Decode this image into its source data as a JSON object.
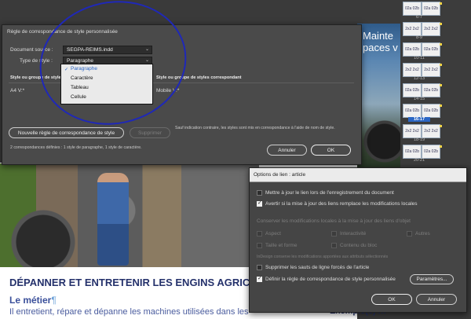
{
  "document": {
    "top_title_lines": [
      "Mainte",
      "paces v"
    ],
    "heading": "DÉPANNER ET ENTRETENIR LES ENGINS AGRICOLES",
    "pilcrow": "¶",
    "subheading": "Le métier",
    "body_text": "Il entretient, répare et dépanne les machines utilisées dans les",
    "right_text": "Exemple(s) m"
  },
  "pages": [
    {
      "thumb": "02a 02b",
      "label": "6-7"
    },
    {
      "thumb": "2x2 2x2",
      "label": "8-9"
    },
    {
      "thumb": "02a 02b",
      "label": "10-11"
    },
    {
      "thumb": "2x2 2x2",
      "label": "12-13"
    },
    {
      "thumb": "02a 02b",
      "label": "14-15"
    },
    {
      "thumb": "02a 02b",
      "label": "16-17",
      "selected": true
    },
    {
      "thumb": "2x2 2x2",
      "label": "18-19"
    },
    {
      "thumb": "02a 02b",
      "label": "20-21"
    }
  ],
  "dialog1": {
    "title": "Règle de correspondance de style personnalisée",
    "source_label": "Document source :",
    "source_value": "SEGPA-REIMS.indd",
    "type_label": "Type de style :",
    "type_value": "Paragraphe",
    "col1_header": "Style ou groupe de style",
    "col2_header": "Style ou groupe de styles correspondant",
    "row_left": "A4 V:*",
    "row_right": "Mobile V:*",
    "options": [
      "Paragraphe",
      "Caractère",
      "Tableau",
      "Cellule"
    ],
    "selected_option": "Paragraphe",
    "new_rule_button": "Nouvelle règle de correspondance de style",
    "delete_button": "Supprimer",
    "note": "Sauf indication contraire, les styles sont mis en correspondance à l'aide de nom de style.",
    "count_text": "2 correspondances définies : 1 style de paragraphe, 1 style de caractère.",
    "cancel_button": "Annuler",
    "ok_button": "OK"
  },
  "dialog2": {
    "title": "Options de lien : article",
    "cb1": "Mettre à jour le lien lors de l'enregistrement du document",
    "cb2": "Avertir si la mise à jour des liens remplace les modifications locales",
    "section_label": "Conserver les modifications locales à la mise à jour des liens d'objet",
    "opt_aspect": "Aspect",
    "opt_interactivite": "Interactivité",
    "opt_autres": "Autres",
    "opt_taille": "Taille et forme",
    "opt_contenu": "Contenu du bloc",
    "indesign_note": "InDesign conserve les modifications apportées aux attributs sélectionnés",
    "cb3": "Supprimer les sauts de ligne forcés de l'article",
    "cb4": "Définir la règle de correspondance de style personnalisée",
    "params_button": "Paramètres...",
    "ok_button": "OK",
    "cancel_button": "Annuler",
    "checked": {
      "cb1": false,
      "cb2": true,
      "cb3": false,
      "cb4": true
    }
  }
}
